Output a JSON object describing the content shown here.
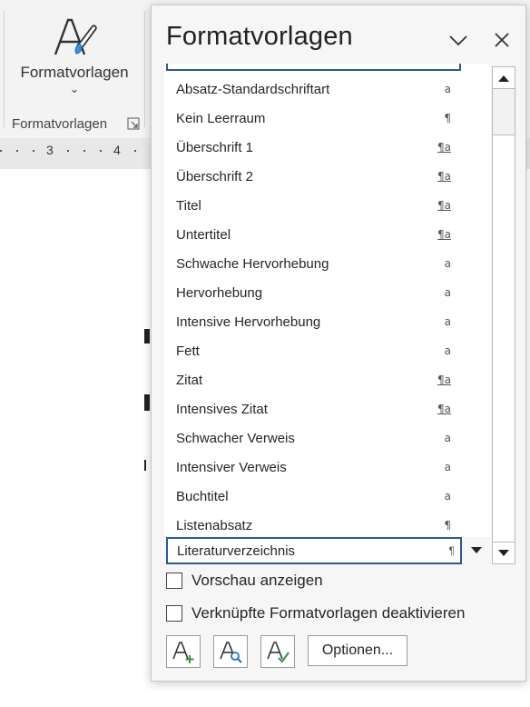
{
  "ribbon": {
    "button_label": "Formatvorlagen",
    "group_label": "Formatvorlagen",
    "button_icon": "styles-brush-icon",
    "dialog_launcher_icon": "dialog-launcher-icon"
  },
  "ruler": {
    "numbers": [
      "3",
      "4"
    ]
  },
  "pane": {
    "title": "Formatvorlagen",
    "collapse_icon": "chevron-down-icon",
    "close_icon": "close-icon",
    "styles": [
      {
        "label": "Absatz-Standardschriftart",
        "symbol": "a",
        "underline": false
      },
      {
        "label": "Kein Leerraum",
        "symbol": "¶",
        "underline": false
      },
      {
        "label": "Überschrift 1",
        "symbol": "¶a",
        "underline": true
      },
      {
        "label": "Überschrift 2",
        "symbol": "¶a",
        "underline": true
      },
      {
        "label": "Titel",
        "symbol": "¶a",
        "underline": true
      },
      {
        "label": "Untertitel",
        "symbol": "¶a",
        "underline": true
      },
      {
        "label": "Schwache Hervorhebung",
        "symbol": "a",
        "underline": false
      },
      {
        "label": "Hervorhebung",
        "symbol": "a",
        "underline": false
      },
      {
        "label": "Intensive Hervorhebung",
        "symbol": "a",
        "underline": false
      },
      {
        "label": "Fett",
        "symbol": "a",
        "underline": false
      },
      {
        "label": "Zitat",
        "symbol": "¶a",
        "underline": true
      },
      {
        "label": "Intensives Zitat",
        "symbol": "¶a",
        "underline": true
      },
      {
        "label": "Schwacher Verweis",
        "symbol": "a",
        "underline": false
      },
      {
        "label": "Intensiver Verweis",
        "symbol": "a",
        "underline": false
      },
      {
        "label": "Buchtitel",
        "symbol": "a",
        "underline": false
      },
      {
        "label": "Listenabsatz",
        "symbol": "¶",
        "underline": false
      }
    ],
    "selected_style": {
      "label": "Literaturverzeichnis",
      "symbol": "¶"
    },
    "preview_checkbox": {
      "label": "Vorschau anzeigen",
      "checked": false
    },
    "linked_checkbox": {
      "label": "Verknüpfte Formatvorlagen deaktivieren",
      "checked": false
    },
    "buttons": {
      "new_style_icon": "new-style-icon",
      "style_inspector_icon": "style-inspector-icon",
      "manage_styles_icon": "manage-styles-icon",
      "options_label": "Optionen..."
    }
  },
  "colors": {
    "accent": "#2b579a",
    "pane_bg": "#f6f6f6",
    "ribbon_bg": "#f3f3f3"
  }
}
